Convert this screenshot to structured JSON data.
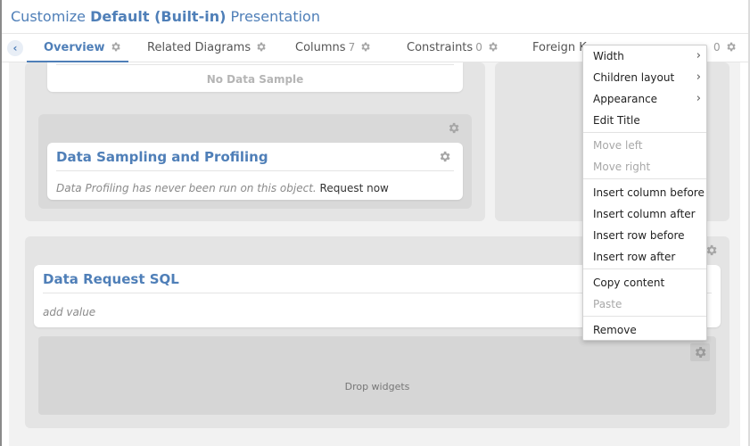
{
  "header": {
    "title_prefix": "Customize ",
    "title_bold": "Default (Built-in)",
    "title_suffix": " Presentation"
  },
  "tabs": [
    {
      "label": "Overview",
      "count": ""
    },
    {
      "label": "Related Diagrams",
      "count": ""
    },
    {
      "label": "Columns",
      "count": "7"
    },
    {
      "label": "Constraints",
      "count": "0"
    },
    {
      "label": "Foreign K",
      "count": ""
    },
    {
      "label": "",
      "count": "0"
    }
  ],
  "widgets": {
    "data_sample": {
      "empty_text": "No Data Sample"
    },
    "profiling": {
      "title": "Data Sampling and Profiling",
      "message": "Data Profiling has never been run on this object.",
      "action": "Request now"
    },
    "sql": {
      "title": "Data Request SQL",
      "placeholder": "add value"
    },
    "drop_zone": {
      "label": "Drop widgets"
    }
  },
  "context_menu": {
    "items": [
      {
        "label": "Width",
        "submenu": true,
        "enabled": true
      },
      {
        "label": "Children layout",
        "submenu": true,
        "enabled": true
      },
      {
        "label": "Appearance",
        "submenu": true,
        "enabled": true
      },
      {
        "label": "Edit Title",
        "submenu": false,
        "enabled": true
      },
      {
        "label": "Move left",
        "submenu": false,
        "enabled": false
      },
      {
        "label": "Move right",
        "submenu": false,
        "enabled": false
      },
      {
        "label": "Insert column before",
        "submenu": false,
        "enabled": true
      },
      {
        "label": "Insert column after",
        "submenu": false,
        "enabled": true
      },
      {
        "label": "Insert row before",
        "submenu": false,
        "enabled": true
      },
      {
        "label": "Insert row after",
        "submenu": false,
        "enabled": true
      },
      {
        "label": "Copy content",
        "submenu": false,
        "enabled": true
      },
      {
        "label": "Paste",
        "submenu": false,
        "enabled": false
      },
      {
        "label": "Remove",
        "submenu": false,
        "enabled": true
      }
    ],
    "submenu_glyph": "›"
  },
  "colors": {
    "accent": "#4f7fb8",
    "canvas": "#f2f2f2",
    "region": "#e4e4e4",
    "gear": "#a6a6a6"
  },
  "icons": {
    "back": "chevron-left-icon",
    "settings": "gear-icon"
  }
}
